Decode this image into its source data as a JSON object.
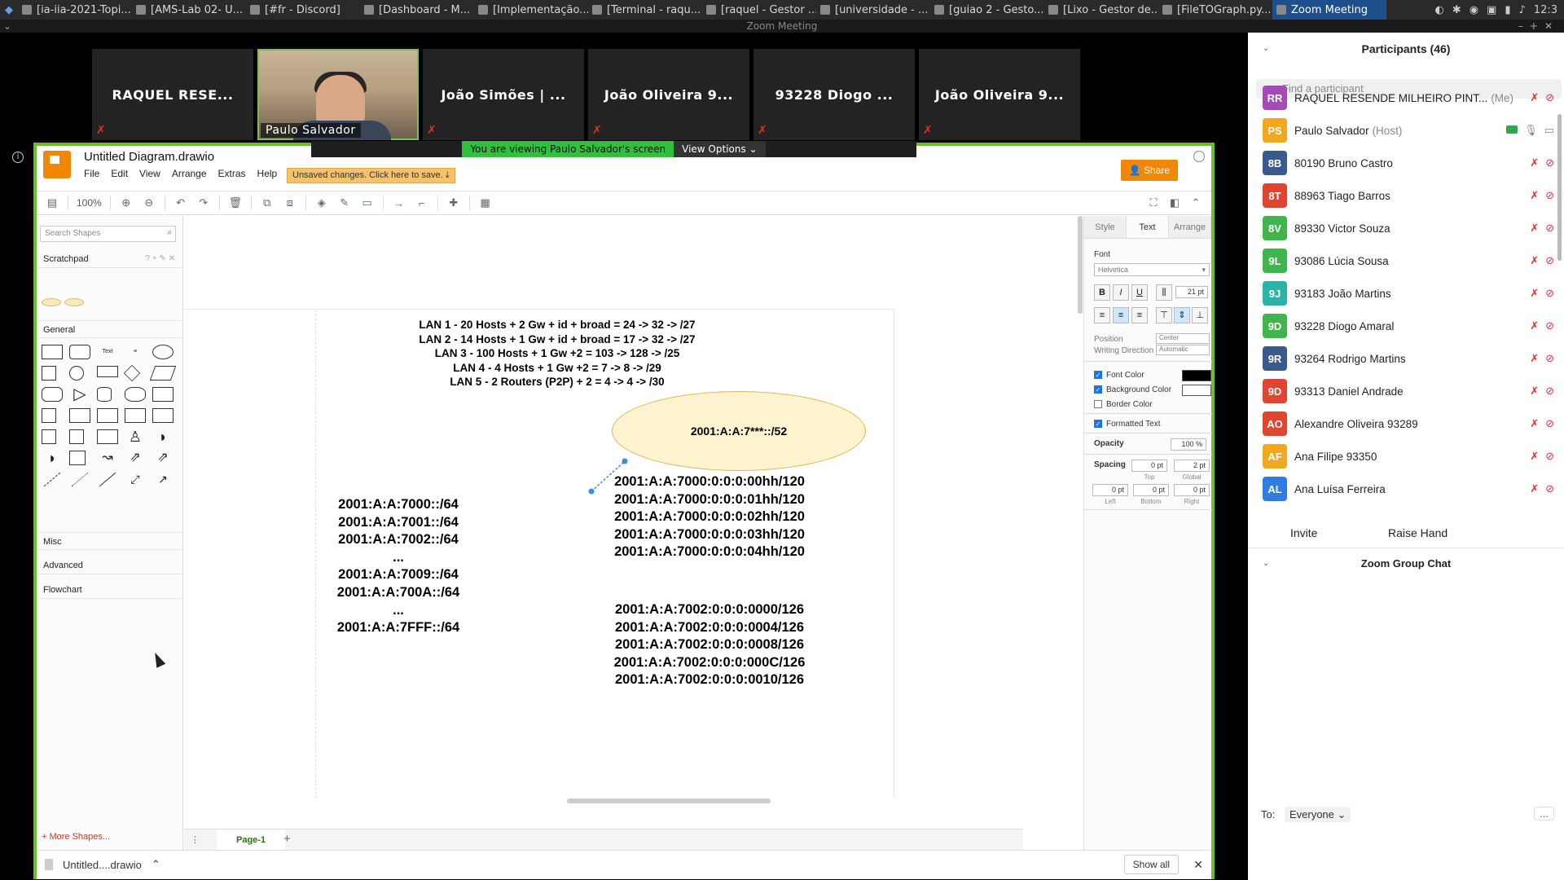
{
  "taskbar": {
    "tasks": [
      {
        "label": "[ia-iia-2021-Topi...",
        "active": false
      },
      {
        "label": "[AMS-Lab 02- U...",
        "active": false
      },
      {
        "label": "[#fr - Discord]",
        "active": false
      },
      {
        "label": "[Dashboard - M...",
        "active": false
      },
      {
        "label": "[Implementação...",
        "active": false
      },
      {
        "label": "[Terminal - raqu...",
        "active": false
      },
      {
        "label": "[raquel - Gestor ...",
        "active": false
      },
      {
        "label": "[universidade - ...",
        "active": false
      },
      {
        "label": "[guiao 2 - Gesto...",
        "active": false
      },
      {
        "label": "[Lixo - Gestor de...",
        "active": false
      },
      {
        "label": "[FileTOGraph.py...",
        "active": false
      },
      {
        "label": "Zoom Meeting",
        "active": true
      }
    ],
    "clock": "12:3"
  },
  "zoom_window": {
    "title": "Zoom Meeting"
  },
  "video_strip": [
    {
      "name": "RAQUEL RESE...",
      "muted": true,
      "video": false
    },
    {
      "name": "Paulo Salvador",
      "muted": false,
      "video": true
    },
    {
      "name": "João Simões | ...",
      "muted": true,
      "video": false
    },
    {
      "name": "João Oliveira 9...",
      "muted": true,
      "video": false
    },
    {
      "name": "93228 Diogo ...",
      "muted": true,
      "video": false
    },
    {
      "name": "João Oliveira 9...",
      "muted": true,
      "video": false
    }
  ],
  "share_banner": {
    "viewing": "You are viewing Paulo Salvador's screen",
    "options": "View Options"
  },
  "drawio": {
    "title": "Untitled Diagram.drawio",
    "menu": [
      "File",
      "Edit",
      "View",
      "Arrange",
      "Extras",
      "Help"
    ],
    "unsaved": "Unsaved changes. Click here to save.",
    "share": "Share",
    "zoom": "100%",
    "search_placeholder": "Search Shapes",
    "sections": {
      "scratchpad": "Scratchpad",
      "general": "General",
      "misc": "Misc",
      "advanced": "Advanced",
      "flowchart": "Flowchart"
    },
    "more_shapes": "+ More Shapes...",
    "page_tab": "Page-1",
    "diagram": {
      "lan_lines": [
        "LAN 1 - 20 Hosts + 2 Gw + id + broad = 24 -> 32 -> /27",
        "LAN 2 - 14 Hosts + 1 Gw + id + broad = 17 -> 32 -> /27",
        "LAN 3 - 100 Hosts + 1 Gw +2 = 103 -> 128 -> /25",
        "LAN 4 - 4 Hosts + 1 Gw +2 = 7 -> 8 -> /29",
        "LAN 5 - 2 Routers (P2P) + 2 = 4 -> 4 -> /30"
      ],
      "ellipse_label": "2001:A:A:7***::/52",
      "left_column": [
        "2001:A:A:7000::/64",
        "2001:A:A:7001::/64",
        "2001:A:A:7002::/64",
        "...",
        "2001:A:A:7009::/64",
        "2001:A:A:700A::/64",
        "...",
        "2001:A:A:7FFF::/64"
      ],
      "right_column_top": [
        "2001:A:A:7000:0:0:0:00hh/120",
        "2001:A:A:7000:0:0:0:01hh/120",
        "2001:A:A:7000:0:0:0:02hh/120",
        "2001:A:A:7000:0:0:0:03hh/120",
        "2001:A:A:7000:0:0:0:04hh/120"
      ],
      "right_column_bottom": [
        "2001:A:A:7002:0:0:0:0000/126",
        "2001:A:A:7002:0:0:0:0004/126",
        "2001:A:A:7002:0:0:0:0008/126",
        "2001:A:A:7002:0:0:0:000C/126",
        "2001:A:A:7002:0:0:0:0010/126"
      ]
    },
    "format_panel": {
      "tabs": [
        "Style",
        "Text",
        "Arrange"
      ],
      "active_tab": "Text",
      "font_label": "Font",
      "font_name": "Helvetica",
      "font_size": "21 pt",
      "position_label": "Position",
      "position_value": "Center",
      "writing_label": "Writing Direction",
      "writing_value": "Automatic",
      "font_color_label": "Font Color",
      "font_color": "#000000",
      "bg_color_label": "Background Color",
      "border_color_label": "Border Color",
      "formatted_label": "Formatted Text",
      "opacity_label": "Opacity",
      "opacity_value": "100 %",
      "spacing_label": "Spacing",
      "spacing_top": "0 pt",
      "spacing_global": "2 pt",
      "spacing_left": "0 pt",
      "spacing_bottom": "0 pt",
      "spacing_right": "0 pt",
      "sub_top": "Top",
      "sub_global": "Global",
      "sub_left": "Left",
      "sub_bottom": "Bottom",
      "sub_right": "Right",
      "bold": "B",
      "italic": "I",
      "underline": "U"
    }
  },
  "download_bar": {
    "file": "Untitled....drawio",
    "show_all": "Show all"
  },
  "participants": {
    "title": "Participants (46)",
    "search_placeholder": "Find a participant",
    "list": [
      {
        "initials": "RR",
        "name": "RAQUEL RESENDE MILHEIRO PINT...",
        "tag": "(Me)",
        "color": "#a44bb7",
        "sharing": false
      },
      {
        "initials": "PS",
        "name": "Paulo Salvador",
        "tag": "(Host)",
        "color": "#f2a81d",
        "sharing": true
      },
      {
        "initials": "8B",
        "name": "80190 Bruno Castro",
        "tag": "",
        "color": "#3a5a8c",
        "sharing": false
      },
      {
        "initials": "8T",
        "name": "88963 Tiago Barros",
        "tag": "",
        "color": "#e0452f",
        "sharing": false
      },
      {
        "initials": "8V",
        "name": "89330 Victor Souza",
        "tag": "",
        "color": "#3fb54b",
        "sharing": false
      },
      {
        "initials": "9L",
        "name": "93086 Lúcia Sousa",
        "tag": "",
        "color": "#3fb54b",
        "sharing": false
      },
      {
        "initials": "9J",
        "name": "93183 João Martins",
        "tag": "",
        "color": "#2bb3a8",
        "sharing": false
      },
      {
        "initials": "9D",
        "name": "93228 Diogo Amaral",
        "tag": "",
        "color": "#3fb54b",
        "sharing": false
      },
      {
        "initials": "9R",
        "name": "93264 Rodrigo Martins",
        "tag": "",
        "color": "#3a5a8c",
        "sharing": false
      },
      {
        "initials": "9D",
        "name": "93313 Daniel Andrade",
        "tag": "",
        "color": "#e0452f",
        "sharing": false
      },
      {
        "initials": "AO",
        "name": "Alexandre Oliveira 93289",
        "tag": "",
        "color": "#e0452f",
        "sharing": false
      },
      {
        "initials": "AF",
        "name": "Ana Filipe 93350",
        "tag": "",
        "color": "#f2a81d",
        "sharing": false
      },
      {
        "initials": "AL",
        "name": "Ana Luísa Ferreira",
        "tag": "",
        "color": "#2f7de1",
        "sharing": false
      }
    ],
    "invite": "Invite",
    "raise_hand": "Raise Hand"
  },
  "chat": {
    "title": "Zoom Group Chat",
    "to_label": "To:",
    "to_value": "Everyone",
    "more": "..."
  }
}
